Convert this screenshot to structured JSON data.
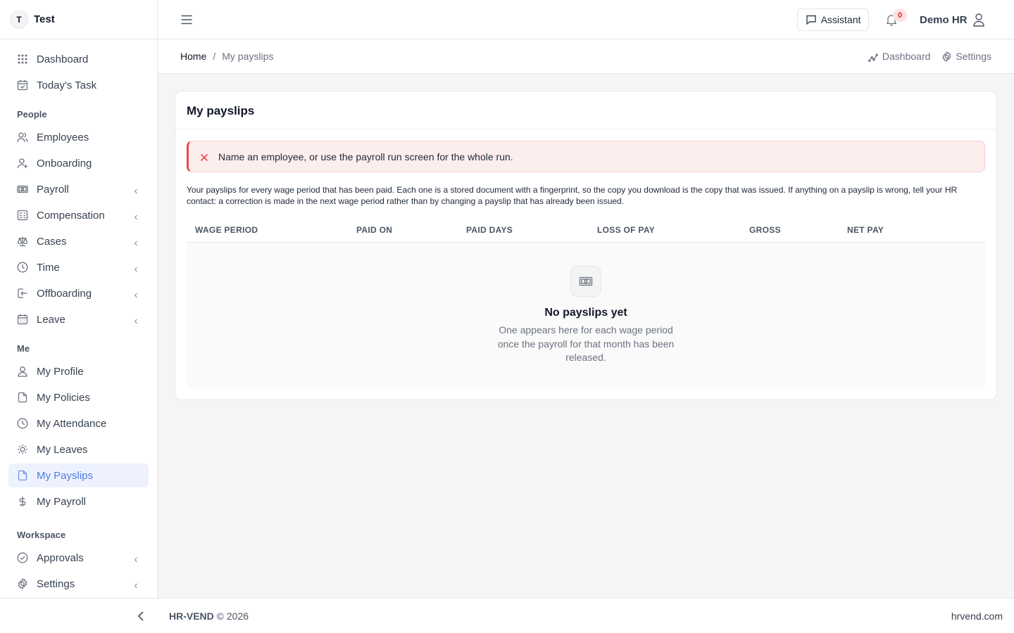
{
  "brand": {
    "initial": "T",
    "name": "Test"
  },
  "sidebar": {
    "top": [
      {
        "label": "Dashboard",
        "icon": "grid-icon"
      },
      {
        "label": "Today's Task",
        "icon": "calendar-check-icon"
      }
    ],
    "sections": [
      {
        "title": "People",
        "items": [
          {
            "label": "Employees",
            "icon": "users-icon",
            "expandable": false
          },
          {
            "label": "Onboarding",
            "icon": "user-plus-icon",
            "expandable": false
          },
          {
            "label": "Payroll",
            "icon": "banknote-icon",
            "expandable": true
          },
          {
            "label": "Compensation",
            "icon": "calculator-icon",
            "expandable": true
          },
          {
            "label": "Cases",
            "icon": "scale-icon",
            "expandable": true
          },
          {
            "label": "Time",
            "icon": "clock-icon",
            "expandable": true
          },
          {
            "label": "Offboarding",
            "icon": "log-out-icon",
            "expandable": true
          },
          {
            "label": "Leave",
            "icon": "calendar-icon",
            "expandable": true
          }
        ]
      },
      {
        "title": "Me",
        "items": [
          {
            "label": "My Profile",
            "icon": "user-icon",
            "expandable": false
          },
          {
            "label": "My Policies",
            "icon": "file-icon",
            "expandable": false
          },
          {
            "label": "My Attendance",
            "icon": "clock-icon",
            "expandable": false
          },
          {
            "label": "My Leaves",
            "icon": "sun-icon",
            "expandable": false
          },
          {
            "label": "My Payslips",
            "icon": "file-icon",
            "expandable": false,
            "active": true
          },
          {
            "label": "My Payroll",
            "icon": "dollar-icon",
            "expandable": false
          }
        ]
      },
      {
        "title": "Workspace",
        "items": [
          {
            "label": "Approvals",
            "icon": "check-circle-icon",
            "expandable": true
          },
          {
            "label": "Settings",
            "icon": "gear-icon",
            "expandable": true
          }
        ]
      }
    ]
  },
  "topbar": {
    "assistant_label": "Assistant",
    "notification_count": "0",
    "user_name": "Demo HR"
  },
  "breadcrumb": {
    "home": "Home",
    "separator": "/",
    "current": "My payslips"
  },
  "quicklinks": {
    "dashboard": "Dashboard",
    "settings": "Settings"
  },
  "card": {
    "title": "My payslips",
    "alert": "Name an employee, or use the payroll run screen for the whole run.",
    "intro": "Your payslips for every wage period that has been paid. Each one is a stored document with a fingerprint, so the copy you download is the copy that was issued. If anything on a payslip is wrong, tell your HR contact: a correction is made in the next wage period rather than by changing a payslip that has already been issued.",
    "columns": [
      "WAGE PERIOD",
      "PAID ON",
      "PAID DAYS",
      "LOSS OF PAY",
      "GROSS",
      "NET PAY"
    ],
    "empty_title": "No payslips yet",
    "empty_desc": "One appears here for each wage period once the payroll for that month has been released."
  },
  "footer": {
    "brand": "HR-VEND",
    "copyright": "© 2026",
    "site": "hrvend.com"
  },
  "colors": {
    "accent": "#4f7fdf",
    "active_bg": "#eef2ff",
    "error": "#e5484d",
    "alert_bg": "#fdeeee"
  }
}
